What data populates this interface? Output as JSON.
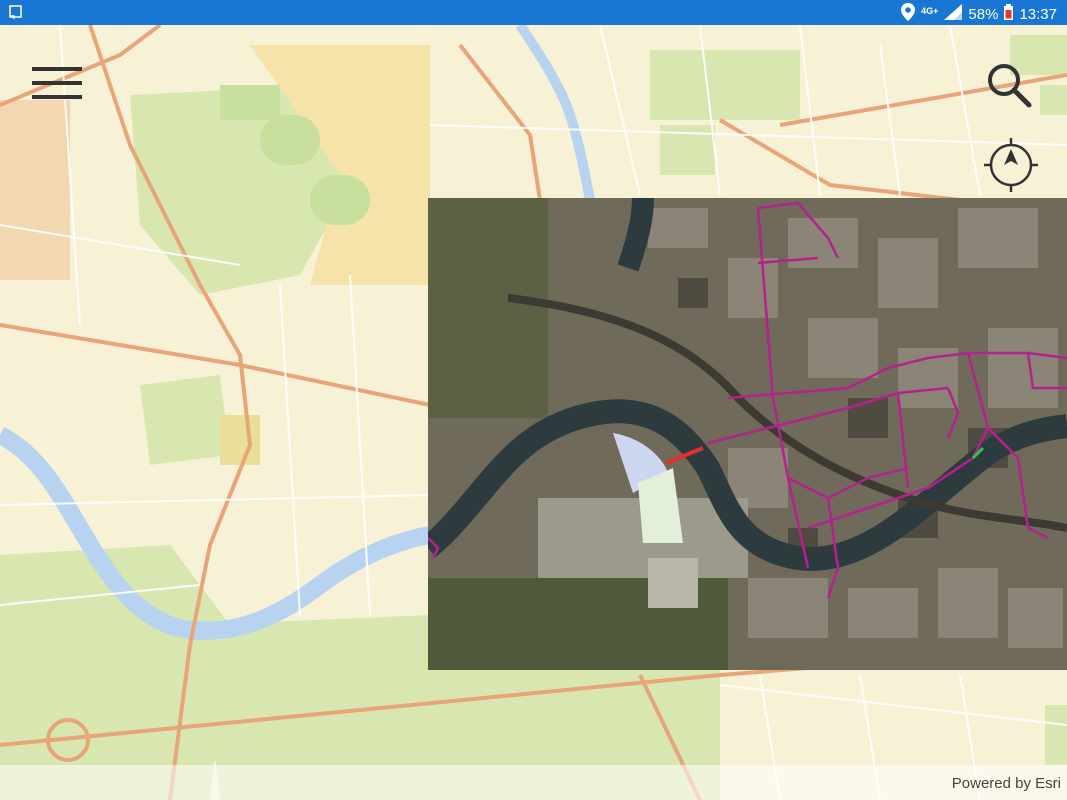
{
  "status_bar": {
    "network": "4G+",
    "battery": "58%",
    "time": "13:37",
    "left_icon": "cast-icon"
  },
  "map": {
    "basemap": "topographic",
    "overlay": "aerial imagery",
    "controls": {
      "menu_icon": "hamburger-menu-icon",
      "search_icon": "search-icon",
      "locate_icon": "compass-locate-icon"
    }
  },
  "attribution": {
    "text": "Powered by Esri"
  },
  "colors": {
    "status_bar": "#1976d2",
    "map_land": "#f7f2d6",
    "park": "#d8e6b0",
    "water": "#b7d3f0",
    "major_road": "#e9a57a",
    "utility_line": "#b5218f"
  }
}
